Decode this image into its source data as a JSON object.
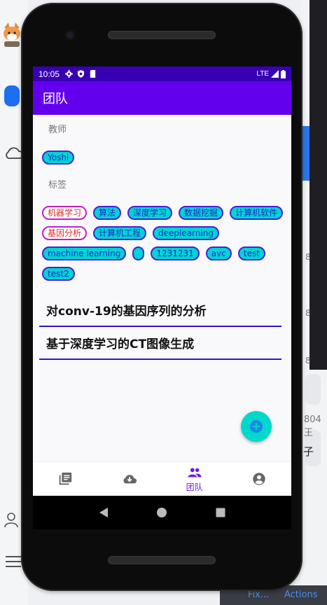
{
  "status_bar": {
    "time": "10:05",
    "network": "LTE",
    "icons": [
      "settings-icon",
      "shield-icon",
      "sdcard-icon",
      "signal-icon",
      "battery-icon"
    ]
  },
  "app_bar": {
    "title": "团队"
  },
  "teachers": {
    "label": "教师",
    "chips": [
      {
        "text": "Yoshi"
      }
    ]
  },
  "tags": {
    "label": "标签",
    "chips": [
      {
        "text": "机器学习",
        "style": "outlined"
      },
      {
        "text": "算法",
        "style": "filled"
      },
      {
        "text": "深度学习",
        "style": "filled"
      },
      {
        "text": "数据挖掘",
        "style": "filled"
      },
      {
        "text": "计算机软件",
        "style": "filled"
      },
      {
        "text": "基因分析",
        "style": "outlined"
      },
      {
        "text": "计算机工程",
        "style": "filled"
      },
      {
        "text": "deeplearning",
        "style": "filled"
      },
      {
        "text": "machine learning",
        "style": "filled"
      },
      {
        "text": "",
        "style": "filled"
      },
      {
        "text": "1231231",
        "style": "filled"
      },
      {
        "text": "avc",
        "style": "filled"
      },
      {
        "text": "test",
        "style": "filled"
      },
      {
        "text": "test2",
        "style": "filled"
      }
    ]
  },
  "projects": [
    {
      "title": "对conv-19的基因序列的分析"
    },
    {
      "title": "基于深度学习的CT图像生成"
    }
  ],
  "fab": {
    "icon": "add-icon"
  },
  "bottom_nav": {
    "items": [
      {
        "icon": "library-icon",
        "label": "",
        "selected": false
      },
      {
        "icon": "cloud-download-icon",
        "label": "",
        "selected": false
      },
      {
        "icon": "people-icon",
        "label": "团队",
        "selected": true
      },
      {
        "icon": "account-icon",
        "label": "",
        "selected": false
      }
    ]
  },
  "colors": {
    "primary": "#6200ee",
    "primary_dark": "#3700b3",
    "chip_fill": "#00d4d4",
    "chip_border": "#4a1fd8",
    "fab": "#00d8cc"
  },
  "background_window": {
    "right_texts": [
      "8",
      "8",
      "8",
      "804王",
      "子",
      "Fix...",
      "Actions"
    ]
  }
}
